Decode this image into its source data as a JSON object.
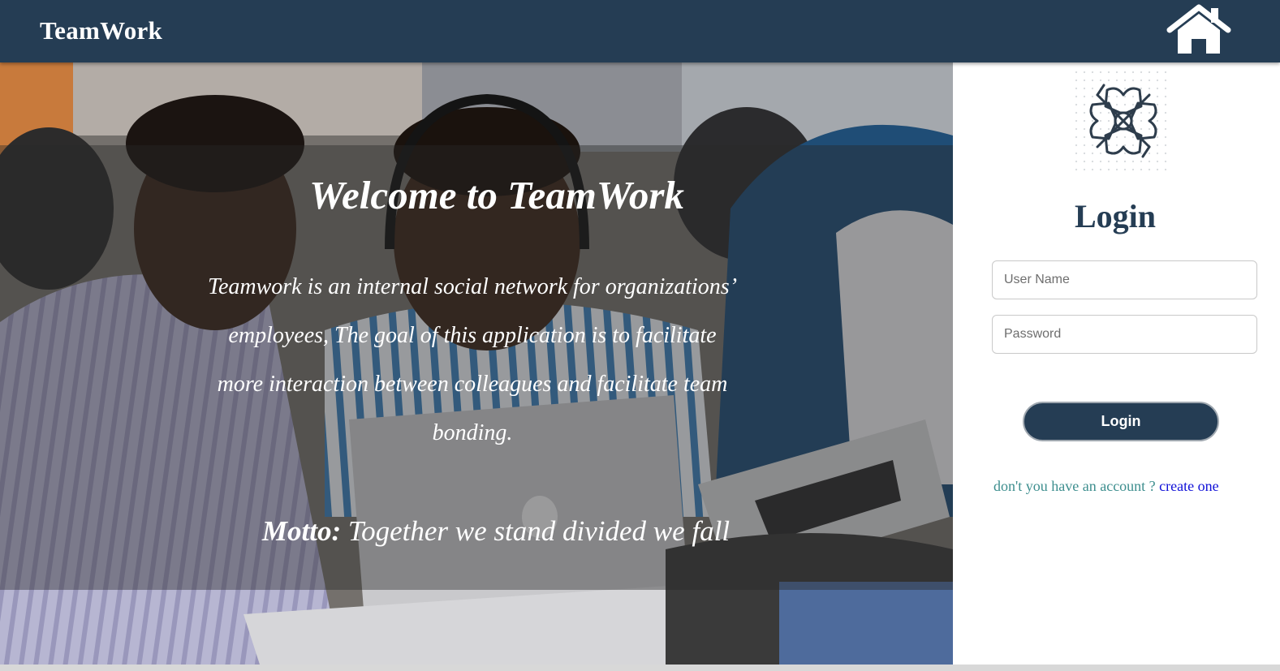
{
  "navbar": {
    "brand": "TeamWork",
    "home_icon": "home-icon",
    "background": "#253d54"
  },
  "hero": {
    "title": "Welcome to TeamWork",
    "description": "Teamwork is an internal social network for organizations’ employees, The goal of this application is to facilitate more interaction between colleagues and facilitate team bonding.",
    "motto_label": "Motto:",
    "motto_text": "Together we stand divided we fall"
  },
  "login": {
    "logo_icon": "teamwork-hands-icon",
    "title": "Login",
    "username_placeholder": "User Name",
    "username_value": "",
    "password_placeholder": "Password",
    "password_value": "",
    "button_label": "Login",
    "signup_prompt": "don't you have an account ?",
    "signup_link": "create one"
  },
  "colors": {
    "primary": "#253d54",
    "signup_prompt": "#3d8e8e",
    "link": "#1010d8"
  }
}
